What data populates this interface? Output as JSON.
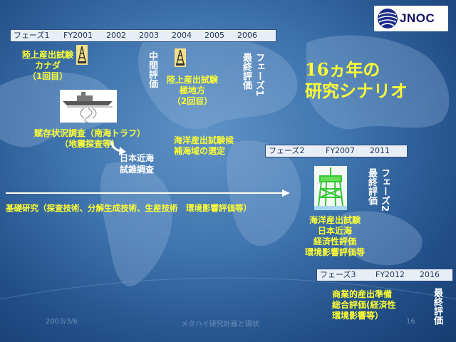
{
  "logo": {
    "text": "JNOC"
  },
  "phase1_bar": {
    "label": "フェーズ1",
    "years": [
      "FY2001",
      "2002",
      "2003",
      "2004",
      "2005",
      "2006"
    ]
  },
  "phase2_bar": {
    "label": "フェーズ2",
    "years": [
      "FY2007",
      "2011"
    ]
  },
  "phase3_bar": {
    "label": "フェーズ3",
    "years": [
      "FY2012",
      "2016"
    ]
  },
  "title": {
    "line1": "16ヵ年の",
    "line2": "研究シナリオ"
  },
  "items": {
    "onshore1": [
      "陸上産出試験",
      "カナダ",
      "（1回目）"
    ],
    "onshore2": [
      "陸上産出試験",
      "極地方",
      "（2回目）"
    ],
    "survey": [
      "賦存状況調査（南海トラフ）",
      "（地震探査等）"
    ],
    "japan_sea": [
      "日本近海",
      "試錐調査"
    ],
    "offshore_select": [
      "海洋産出試験候",
      "補海域の選定"
    ],
    "offshore_test": [
      "海洋産出試験",
      "日本近海",
      "経済性評価",
      "環境影響評価等"
    ],
    "commercial": [
      "商業的産出準備",
      "総合評価(経済性",
      "環境影響等）"
    ],
    "basic_research": "基礎研究（探査技術、分解生成技術、生産技術　環境影響評価等）"
  },
  "vertical": {
    "midterm": "中間評価",
    "phase1_end_a": "フェーズ1",
    "phase1_end_b": "最終評価",
    "phase2_end_a": "フェーズ2",
    "phase2_end_b": "最終評価",
    "final": "最終評価"
  },
  "footer": {
    "date": "2003/3/6",
    "title": "メタハイ研究計画と現状",
    "page": "16"
  },
  "icons": [
    "rig-icon",
    "ship-icon",
    "platform-icon",
    "globe-logo-icon"
  ]
}
